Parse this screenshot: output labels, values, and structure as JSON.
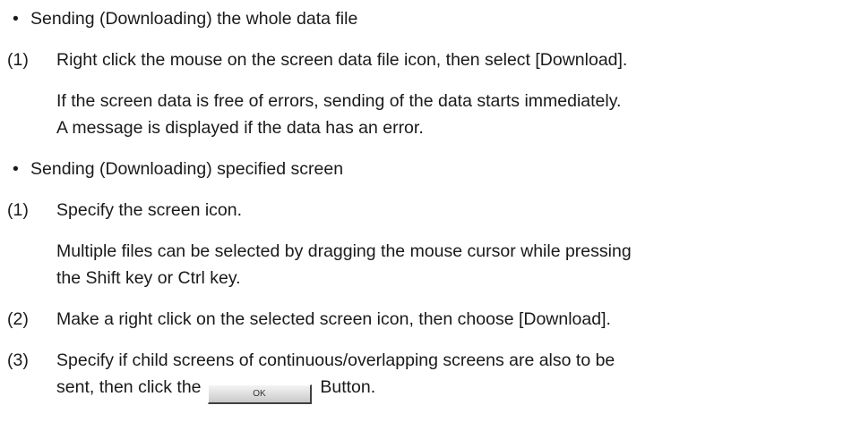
{
  "sections": [
    {
      "bullet": "•",
      "heading": "Sending (Downloading) the whole data file",
      "steps": [
        {
          "number": "(1)",
          "text": "Right click the mouse on the screen data file icon, then select [Download].",
          "notes": [
            "If the screen data is free of errors, sending of the data starts immediately.",
            "A message is displayed if the data has an error."
          ]
        }
      ]
    },
    {
      "bullet": "•",
      "heading": "Sending (Downloading) specified screen",
      "steps": [
        {
          "number": "(1)",
          "text": "Specify the screen icon.",
          "notes": [
            "Multiple files can be selected by dragging the mouse cursor while pressing",
            "the Shift key or Ctrl key."
          ]
        },
        {
          "number": "(2)",
          "text": "Make a right click on the selected screen icon, then choose [Download]."
        },
        {
          "number": "(3)",
          "text": "Specify if child screens of continuous/overlapping screens are also to be",
          "text_cont_before": "sent, then click the",
          "button_label": "OK",
          "text_cont_after": "Button."
        }
      ]
    }
  ]
}
